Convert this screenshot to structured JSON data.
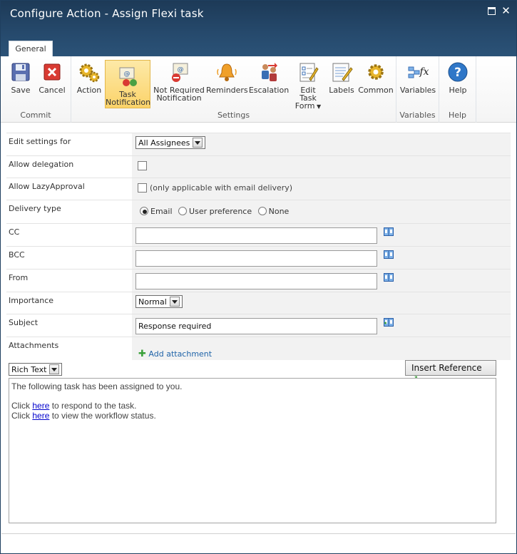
{
  "window": {
    "title": "Configure Action - Assign Flexi task"
  },
  "tabs": {
    "general": "General"
  },
  "ribbon": {
    "commit": {
      "label": "Commit",
      "save": "Save",
      "cancel": "Cancel"
    },
    "settings": {
      "label": "Settings",
      "action": "Action",
      "task_notification_1": "Task",
      "task_notification_2": "Notification",
      "not_required_1": "Not Required",
      "not_required_2": "Notification",
      "reminders": "Reminders",
      "escalation": "Escalation",
      "edit_task_form_1": "Edit Task",
      "edit_task_form_2": "Form",
      "labels": "Labels",
      "common": "Common"
    },
    "variables": {
      "label": "Variables",
      "variables": "Variables"
    },
    "help": {
      "label": "Help",
      "help": "Help"
    }
  },
  "form": {
    "edit_settings_for": {
      "label": "Edit settings for",
      "value": "All Assignees"
    },
    "allow_delegation": {
      "label": "Allow delegation",
      "checked": false
    },
    "allow_lazy": {
      "label": "Allow LazyApproval",
      "note": "(only applicable with email delivery)",
      "checked": false
    },
    "delivery_type": {
      "label": "Delivery type",
      "options": [
        "Email",
        "User preference",
        "None"
      ],
      "selected": "Email"
    },
    "cc": {
      "label": "CC",
      "value": ""
    },
    "bcc": {
      "label": "BCC",
      "value": ""
    },
    "from": {
      "label": "From",
      "value": ""
    },
    "importance": {
      "label": "Importance",
      "value": "Normal"
    },
    "subject": {
      "label": "Subject",
      "value": "Response required"
    },
    "attachments": {
      "label": "Attachments",
      "add": "Add attachment"
    }
  },
  "body": {
    "format": "Rich Text",
    "insert_reference": "Insert Reference",
    "line1": "The following task has been assigned to you.",
    "click": "Click",
    "here": "here",
    "line2_rest": "to respond to the task.",
    "line3_rest": "to view the workflow status."
  },
  "colors": {
    "titlebar": "#264a6d",
    "selected": "#fbd36a",
    "link": "#0000cc"
  }
}
